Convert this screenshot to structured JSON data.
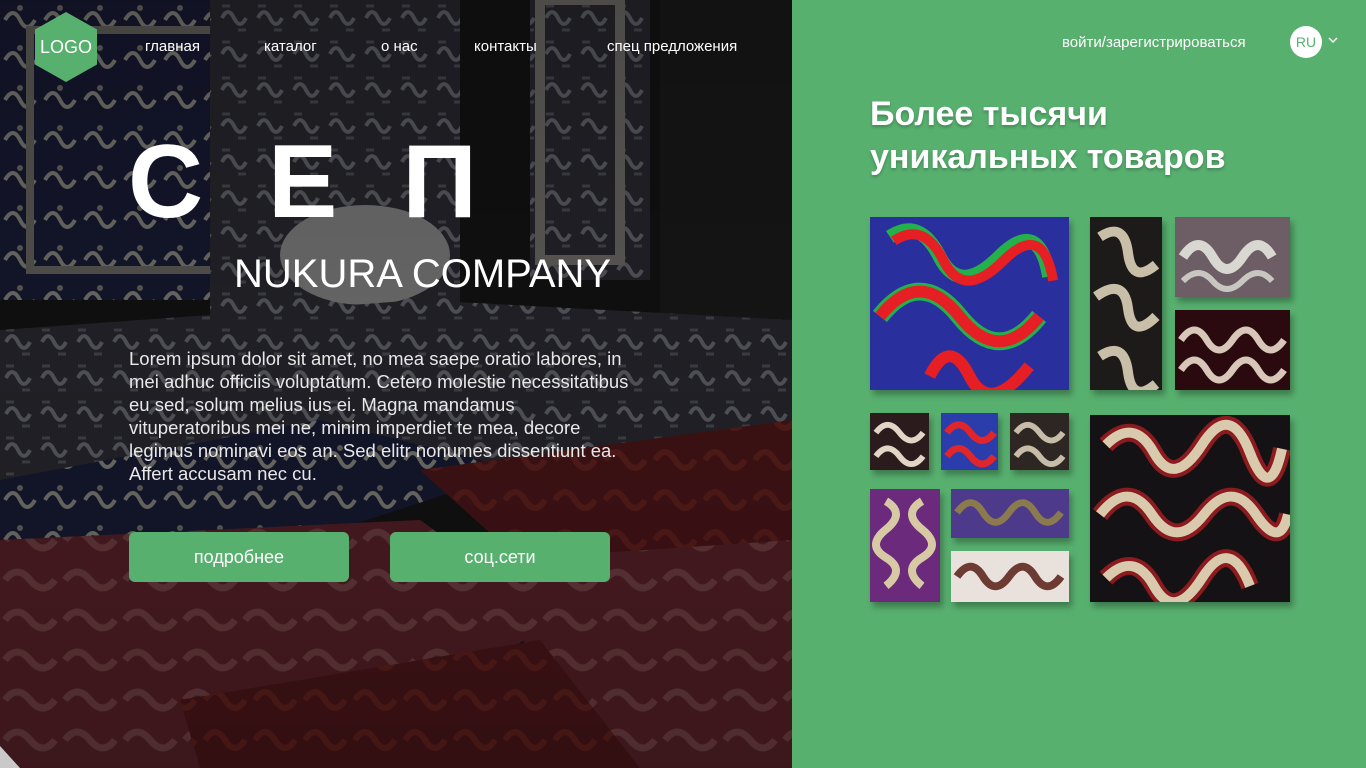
{
  "logo": {
    "text": "LOGO"
  },
  "nav": [
    {
      "label": "главная"
    },
    {
      "label": "каталог"
    },
    {
      "label": "о нас"
    },
    {
      "label": "контакты"
    },
    {
      "label": "спец предложения"
    }
  ],
  "hero": {
    "title": "С Е П",
    "company": "NUKURA COMPANY",
    "description": "Lorem ipsum dolor sit amet, no mea saepe oratio labores, in mei adhuc officiis voluptatum. Cetero molestie necessitatibus eu sed, solum melius ius ei. Magna mandamus vituperatoribus mei ne, minim imperdiet te mea, decore legimus nominavi eos an. Sed elitr nonumes dissentiunt ea. Affert accusam nec cu.",
    "more_button": "подробнее",
    "social_button": "соц.сети"
  },
  "header_right": {
    "login": "войти/зарегистрироваться",
    "lang": "RU"
  },
  "panel": {
    "headline": "Более тысячи уникальных товаров"
  },
  "colors": {
    "accent": "#58b06f",
    "white": "#ffffff"
  }
}
